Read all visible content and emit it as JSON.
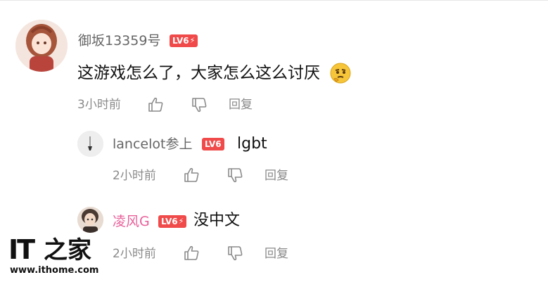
{
  "comment": {
    "username": "御坂13359号",
    "level": "LV6",
    "text": "这游戏怎么了，大家怎么这么讨厌",
    "time": "3小时前",
    "reply_label": "回复"
  },
  "replies": [
    {
      "username": "lancelot参上",
      "level": "LV6",
      "text": "lgbt",
      "time": "2小时前",
      "reply_label": "回复"
    },
    {
      "username": "凌风G",
      "level": "LV6",
      "text": "没中文",
      "time": "2小时前",
      "reply_label": "回复"
    }
  ],
  "watermark": {
    "logo_it": "IT",
    "logo_zhi": "之家",
    "url": "www.ithome.com"
  },
  "colors": {
    "level_badge": "#f04a4a",
    "username_highlight": "#e8609a",
    "meta_gray": "#8a8a8a"
  },
  "icons": [
    "thumbs-up-icon",
    "thumbs-down-icon",
    "thinking-face-emoji",
    "lightning-icon"
  ]
}
